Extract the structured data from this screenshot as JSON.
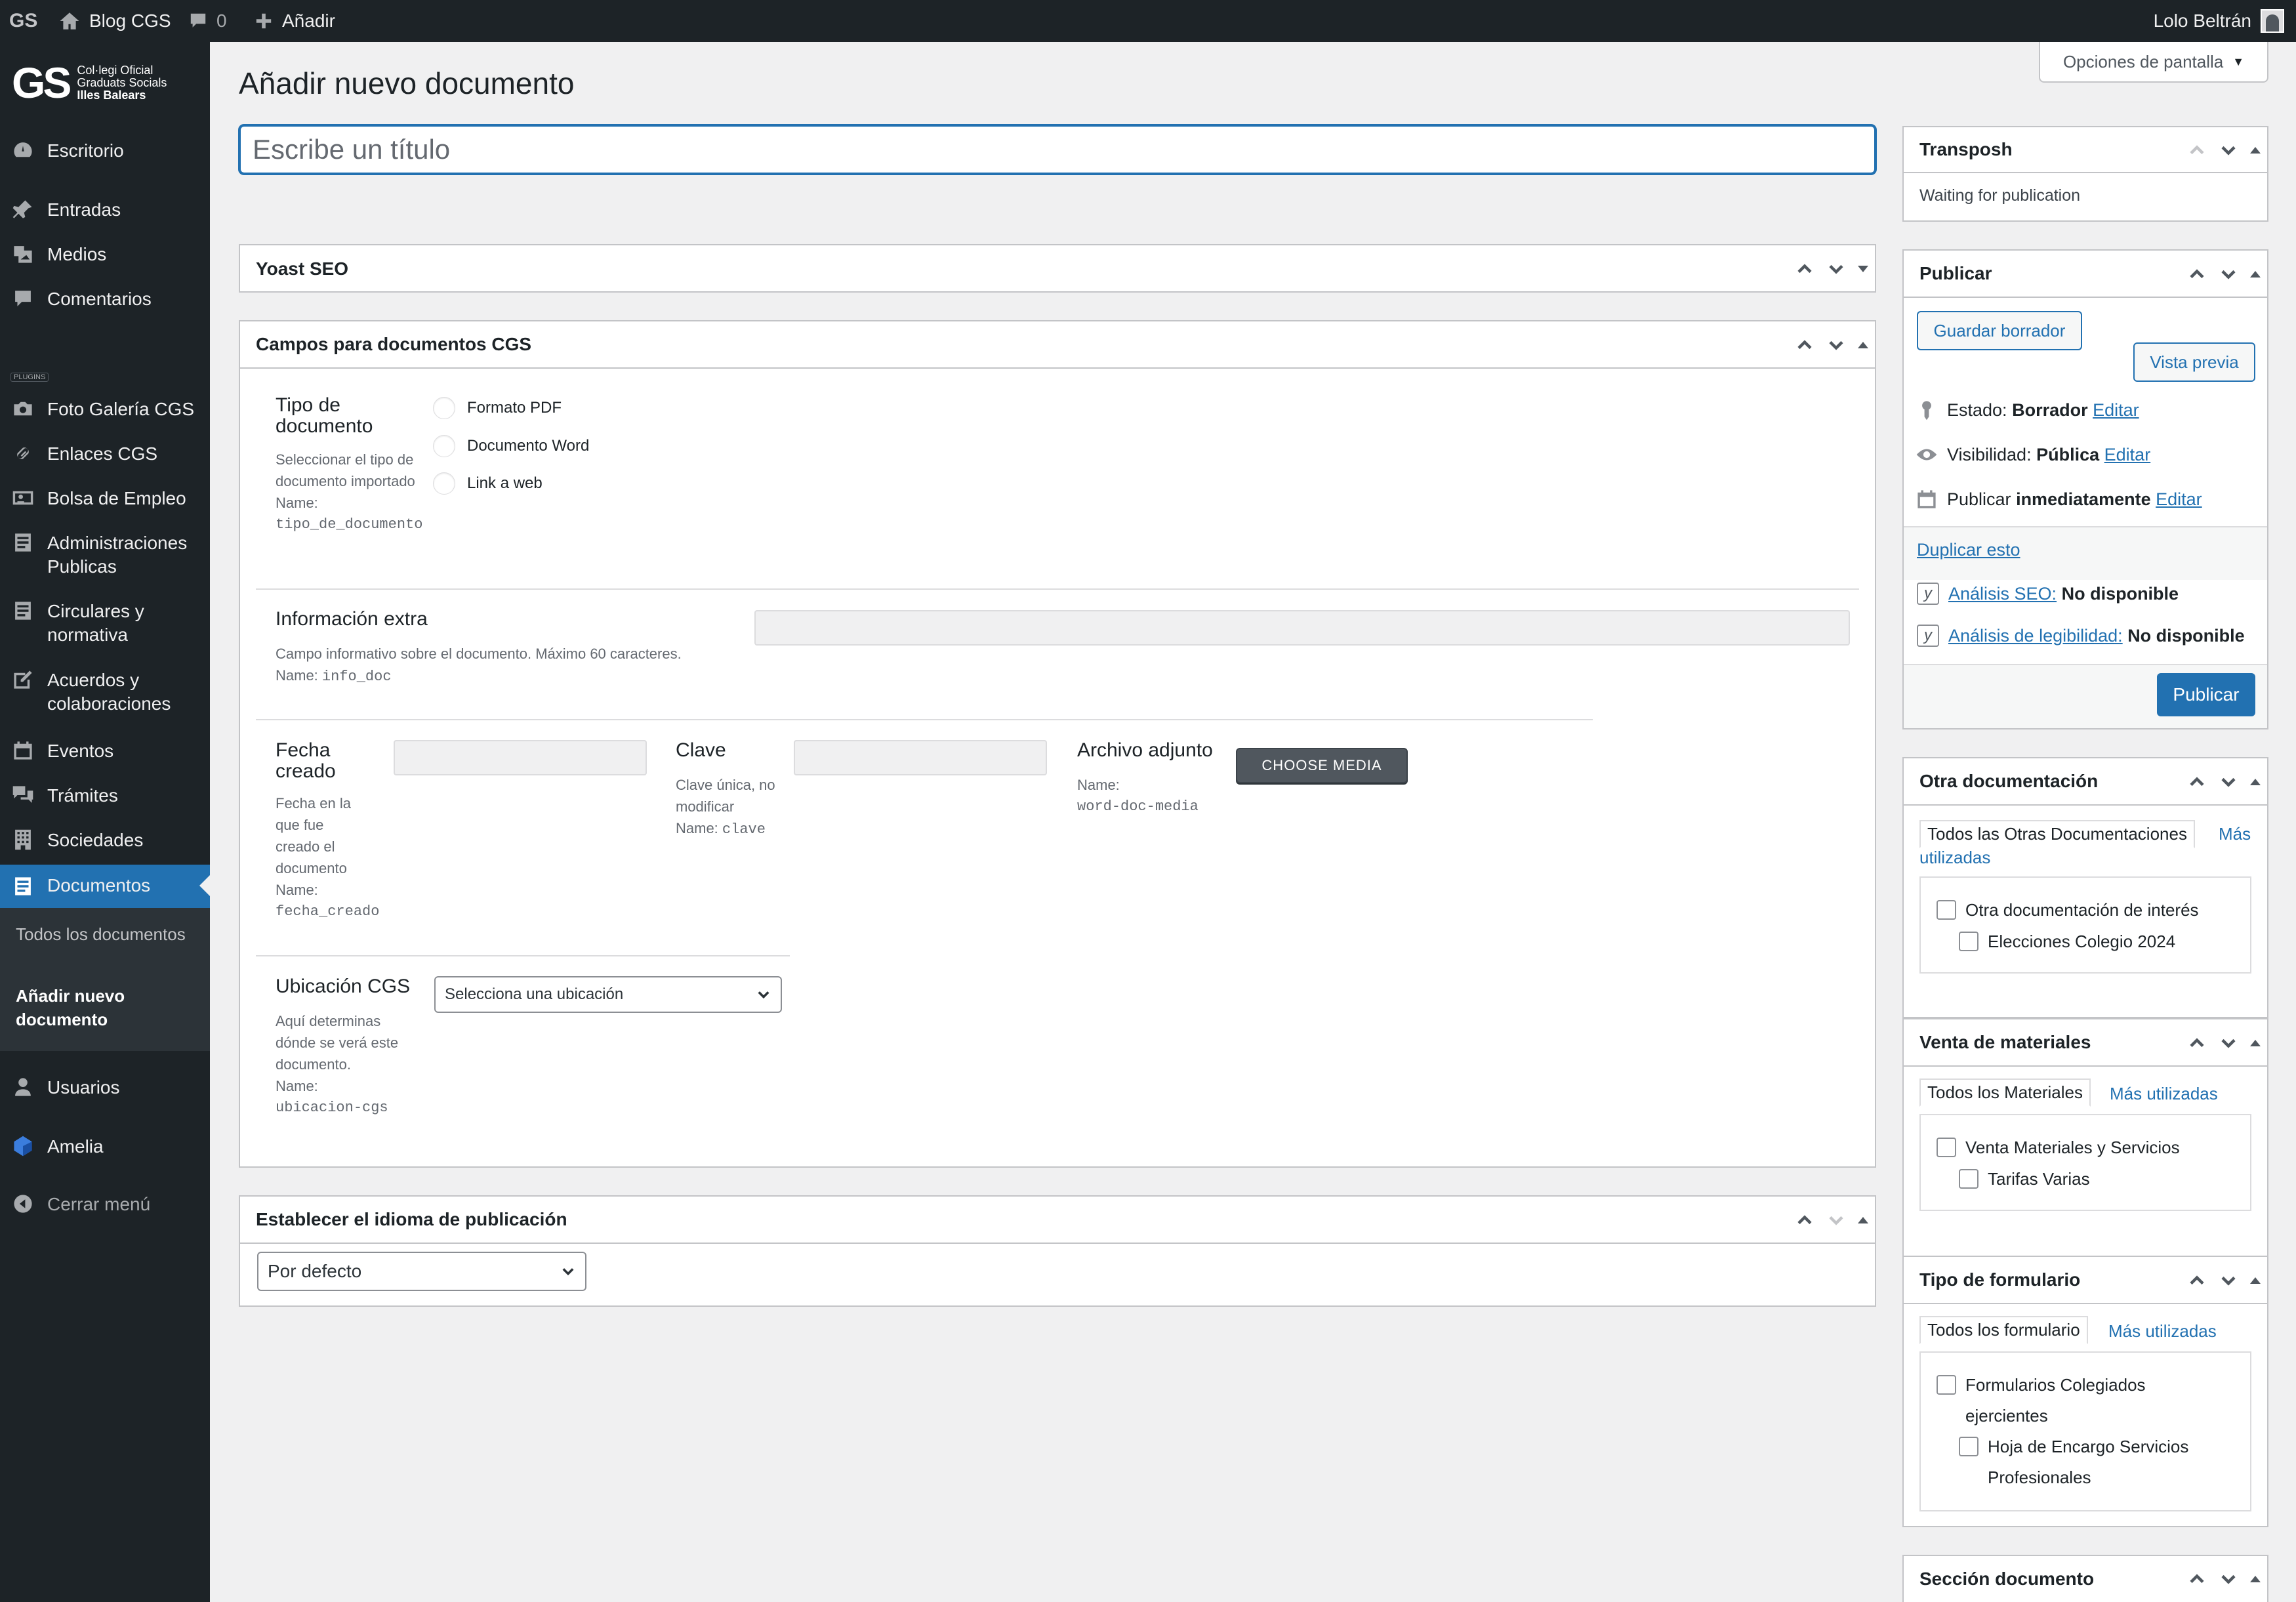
{
  "admin_bar": {
    "logo": "GS",
    "site_name": "Blog CGS",
    "comments_count": "0",
    "new_label": "Añadir",
    "user_name": "Lolo Beltrán"
  },
  "brand": {
    "logo_letters": "GS",
    "line1": "Col·legi Oficial",
    "line2": "Graduats Socials",
    "line3": "Illes Balears"
  },
  "sidebar": {
    "plugins_label": "PLUGINS",
    "items": [
      {
        "label": "Escritorio",
        "icon": "dashboard-icon"
      },
      {
        "label": "Entradas",
        "icon": "pin-icon"
      },
      {
        "label": "Medios",
        "icon": "media-icon"
      },
      {
        "label": "Comentarios",
        "icon": "comment-icon"
      },
      {
        "label": "Foto Galería CGS",
        "icon": "camera-icon"
      },
      {
        "label": "Enlaces CGS",
        "icon": "link-icon"
      },
      {
        "label": "Bolsa de Empleo",
        "icon": "id-card-icon"
      },
      {
        "label": "Administraciones Publicas",
        "icon": "document-icon"
      },
      {
        "label": "Circulares y normativa",
        "icon": "document-icon"
      },
      {
        "label": "Acuerdos y colaboraciones",
        "icon": "edit-icon"
      },
      {
        "label": "Eventos",
        "icon": "calendar-icon"
      },
      {
        "label": "Trámites",
        "icon": "comments-icon"
      },
      {
        "label": "Sociedades",
        "icon": "building-icon"
      },
      {
        "label": "Documentos",
        "icon": "document-icon"
      },
      {
        "label": "Usuarios",
        "icon": "user-icon"
      },
      {
        "label": "Amelia",
        "icon": "amelia-icon"
      },
      {
        "label": "Cerrar menú",
        "icon": "collapse-icon"
      }
    ],
    "submenu": [
      "Todos los documentos",
      "Añadir nuevo documento"
    ]
  },
  "page": {
    "title": "Añadir nuevo documento",
    "screen_options": "Opciones de pantalla",
    "title_placeholder": "Escribe un título"
  },
  "yoast": {
    "title": "Yoast SEO"
  },
  "campos": {
    "title": "Campos para documentos CGS",
    "tipo": {
      "label": "Tipo de documento",
      "desc": "Seleccionar el tipo de documento importado",
      "name_prefix": "Name:",
      "name": "tipo_de_documento",
      "options": [
        "Formato PDF",
        "Documento Word",
        "Link a web"
      ]
    },
    "info": {
      "label": "Información extra",
      "desc": "Campo informativo sobre el documento. Máximo 60 caracteres.",
      "name_prefix": "Name:",
      "name": "info_doc"
    },
    "fecha": {
      "label": "Fecha creado",
      "desc": "Fecha en la que fue creado el documento",
      "name_prefix": "Name:",
      "name": "fecha_creado"
    },
    "clave": {
      "label": "Clave",
      "desc": "Clave única, no modificar",
      "name_prefix": "Name:",
      "name": "clave"
    },
    "archivo": {
      "label": "Archivo adjunto",
      "name_prefix": "Name:",
      "name": "word-doc-media",
      "button": "CHOOSE MEDIA"
    },
    "ubicacion": {
      "label": "Ubicación CGS",
      "desc": "Aquí determinas dónde se verá este documento.",
      "name_prefix": "Name:",
      "name": "ubicacion-cgs",
      "select_value": "Selecciona una ubicación"
    }
  },
  "idioma": {
    "title": "Establecer el idioma de publicación",
    "select_value": "Por defecto"
  },
  "transposh": {
    "title": "Transposh",
    "status": "Waiting for publication"
  },
  "publicar": {
    "title": "Publicar",
    "save_draft": "Guardar borrador",
    "preview": "Vista previa",
    "estado_label": "Estado:",
    "estado_value": "Borrador",
    "visibilidad_label": "Visibilidad:",
    "visibilidad_value": "Pública",
    "publicar_label": "Publicar",
    "publicar_value": "inmediatamente",
    "edit": "Editar",
    "duplicate": "Duplicar esto",
    "seo_label": "Análisis SEO:",
    "seo_value": "No disponible",
    "read_label": "Análisis de legibilidad:",
    "read_value": "No disponible",
    "publish_button": "Publicar"
  },
  "otra_doc": {
    "title": "Otra documentación",
    "tab_all": "Todos las Otras Documentaciones",
    "tab_most_1": "Más",
    "tab_most_2": "utilizadas",
    "items": [
      "Otra documentación de interés",
      "Elecciones Colegio 2024"
    ]
  },
  "venta": {
    "title": "Venta de materiales",
    "tab_all": "Todos los Materiales",
    "tab_most": "Más utilizadas",
    "items": [
      "Venta Materiales y Servicios",
      "Tarifas Varias"
    ]
  },
  "tipo_form": {
    "title": "Tipo de formulario",
    "tab_all": "Todos los formulario",
    "tab_most": "Más utilizadas",
    "items": [
      "Formularios Colegiados ejercientes",
      "Hoja de Encargo Servicios Profesionales"
    ]
  },
  "seccion": {
    "title": "Sección documento"
  }
}
